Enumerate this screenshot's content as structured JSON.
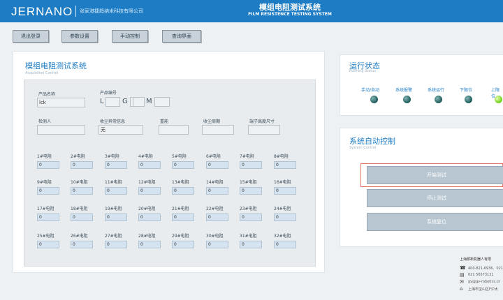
{
  "header": {
    "logo": "JERNANO",
    "company": "张家港捷趋纳米科技有限公司",
    "title": "模组电阻测试系统",
    "subtitle": "FILM RESISTENCE TESTING SYSTEM"
  },
  "nav": [
    "退出登录",
    "参数设置",
    "手动控制",
    "查询界面"
  ],
  "acquisition": {
    "title": "模组电阻测试系统",
    "subtitle": "Acquisition Control",
    "product_name_label": "产品名称",
    "product_name_value": "lck",
    "product_no_label": "产品编号",
    "product_no_prefixes": [
      "L",
      "G",
      "M"
    ],
    "operator_label": "检测人",
    "operator_value": "",
    "abnormal_label": "收尘异常信息",
    "abnormal_value": "无",
    "f3_label": "重能",
    "f4_label": "收尘周期",
    "f5_label": "端子高度尺寸",
    "resistors": [
      {
        "label": "1#电阻",
        "value": "0"
      },
      {
        "label": "2#电阻",
        "value": "0"
      },
      {
        "label": "3#电阻",
        "value": "0"
      },
      {
        "label": "4#电阻",
        "value": "0"
      },
      {
        "label": "5#电阻",
        "value": "0"
      },
      {
        "label": "6#电阻",
        "value": "0"
      },
      {
        "label": "7#电阻",
        "value": "0"
      },
      {
        "label": "8#电阻",
        "value": "0"
      },
      {
        "label": "9#电阻",
        "value": "0"
      },
      {
        "label": "10#电阻",
        "value": "0"
      },
      {
        "label": "11#电阻",
        "value": "0"
      },
      {
        "label": "12#电阻",
        "value": "0"
      },
      {
        "label": "13#电阻",
        "value": "0"
      },
      {
        "label": "14#电阻",
        "value": "0"
      },
      {
        "label": "15#电阻",
        "value": "0"
      },
      {
        "label": "16#电阻",
        "value": "0"
      },
      {
        "label": "17#电阻",
        "value": "0"
      },
      {
        "label": "18#电阻",
        "value": "0"
      },
      {
        "label": "19#电阻",
        "value": "0"
      },
      {
        "label": "20#电阻",
        "value": "0"
      },
      {
        "label": "21#电阻",
        "value": "0"
      },
      {
        "label": "22#电阻",
        "value": "0"
      },
      {
        "label": "23#电阻",
        "value": "0"
      },
      {
        "label": "24#电阻",
        "value": "0"
      },
      {
        "label": "25#电阻",
        "value": "0"
      },
      {
        "label": "26#电阻",
        "value": "0"
      },
      {
        "label": "27#电阻",
        "value": "0"
      },
      {
        "label": "28#电阻",
        "value": "0"
      },
      {
        "label": "29#电阻",
        "value": "0"
      },
      {
        "label": "30#电阻",
        "value": "0"
      },
      {
        "label": "31#电阻",
        "value": "0"
      },
      {
        "label": "32#电阻",
        "value": "0"
      }
    ]
  },
  "running_status": {
    "title": "运行状态",
    "subtitle": "Running Status",
    "items": [
      {
        "label": "手动/自动",
        "state": "off"
      },
      {
        "label": "系统报警",
        "state": "off"
      },
      {
        "label": "系统运行",
        "state": "off"
      },
      {
        "label": "下限位",
        "state": "off"
      },
      {
        "label": "上限位",
        "state": "on"
      }
    ]
  },
  "auto_control": {
    "title": "系统自动控制",
    "subtitle": "System Control",
    "start": "开始测试",
    "stop": "停止测试",
    "reset": "系统复位"
  },
  "footer": {
    "name": "上海那新机器人有限",
    "phone": "400-821-6936、021",
    "fax": "021 56573121",
    "email": "qy@gy-robotics.cn",
    "address": "上海市宝山区F沪太"
  },
  "colors": {
    "header": "#1e7cc4",
    "lamp_off": "#1f5a5c",
    "lamp_on": "#6fd11c",
    "highlight": "#e5776c"
  }
}
